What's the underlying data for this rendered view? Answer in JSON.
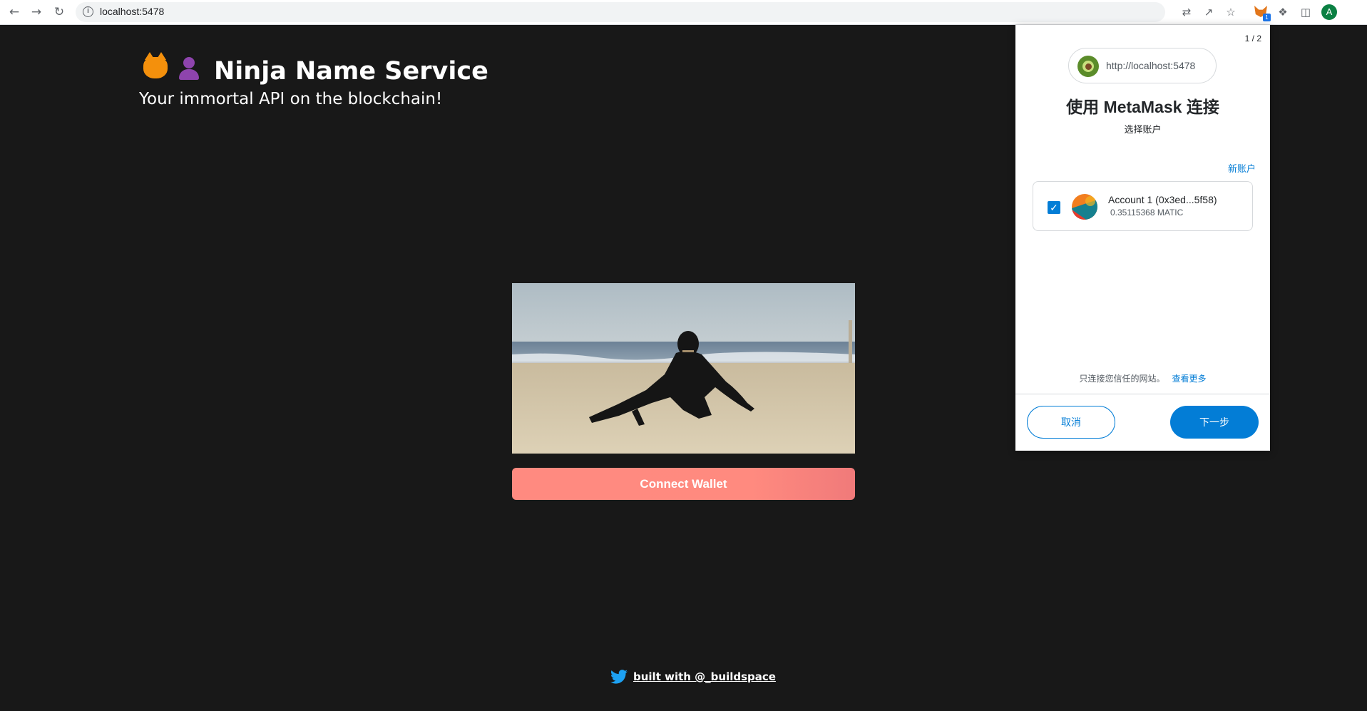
{
  "browser": {
    "url": "localhost:5478",
    "nav_icons": [
      "back-icon",
      "forward-icon",
      "reload-icon"
    ],
    "toolbar_icons": [
      "translate-icon",
      "share-icon",
      "bookmark-star-icon",
      "metamask-fox-icon",
      "extensions-puzzle-icon",
      "side-panel-icon"
    ],
    "extension_badge": "1",
    "profile_initial": "A"
  },
  "page": {
    "title": "Ninja Name Service",
    "subtitle": "Your immortal API on the blockchain!",
    "emojis": [
      "cat-face-emoji",
      "ninja-emoji"
    ],
    "connect_button": "Connect Wallet",
    "footer_text": "built with @_buildspace",
    "footer_icon": "twitter-icon",
    "colors": {
      "background": "#181818",
      "connect_button": "#ff8a80",
      "footer_icon": "#1da1f2"
    }
  },
  "metamask": {
    "page_count": "1 / 2",
    "origin": "http://localhost:5478",
    "heading": "使用 MetaMask 连接",
    "subheading": "选择账户",
    "new_account": "新账户",
    "account": {
      "name": "Account 1 (0x3ed...5f58)",
      "balance": "0.35115368 MATIC",
      "checked": true
    },
    "trust_text": "只连接您信任的网站。",
    "learn_more": "查看更多",
    "cancel": "取消",
    "next": "下一步",
    "colors": {
      "primary": "#037dd6",
      "border": "#d6d9dc"
    }
  }
}
